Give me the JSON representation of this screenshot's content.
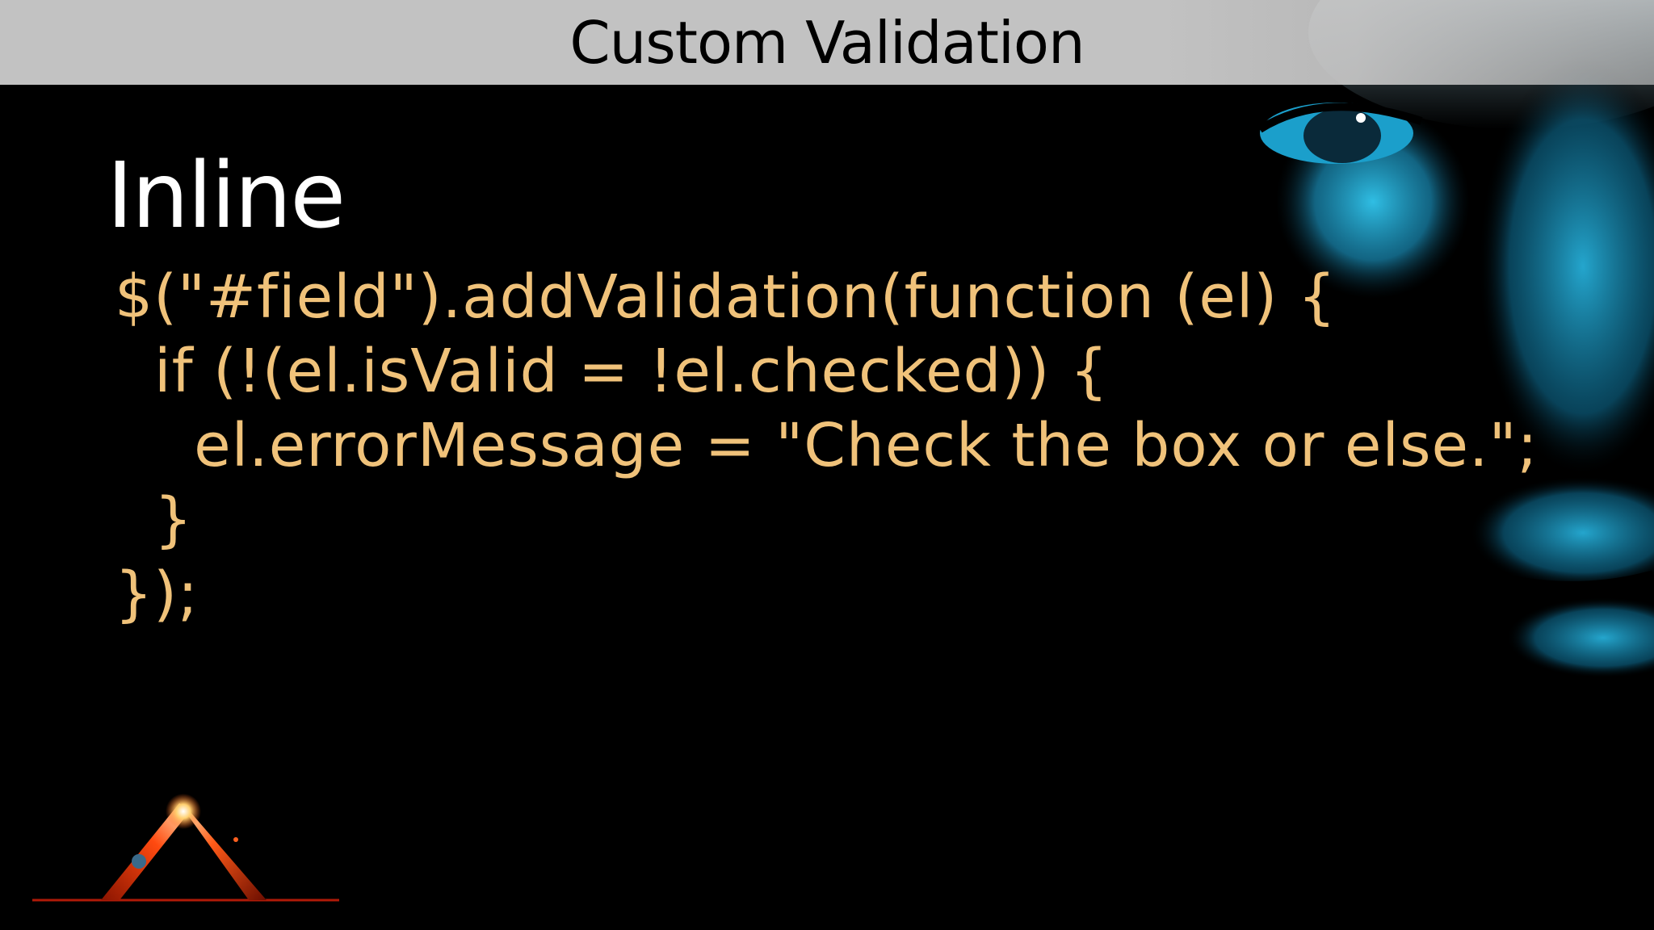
{
  "slide": {
    "title": "Custom Validation",
    "section_heading": "Inline",
    "code_lines": [
      "$(\"#field\").addValidation(function (el) {",
      "  if (!(el.isValid = !el.checked)) {",
      "    el.errorMessage = \"Check the box or else.\";",
      "  }",
      "});"
    ]
  },
  "colors": {
    "title_bar": "#c2c2c2",
    "heading_text": "#ffffff",
    "code_text": "#f0c27a",
    "face_tint": "#1aa6cf",
    "background": "#000000"
  },
  "icons": {
    "background_art": "blue-face-art",
    "logo": "glowing-triangle-logo"
  }
}
